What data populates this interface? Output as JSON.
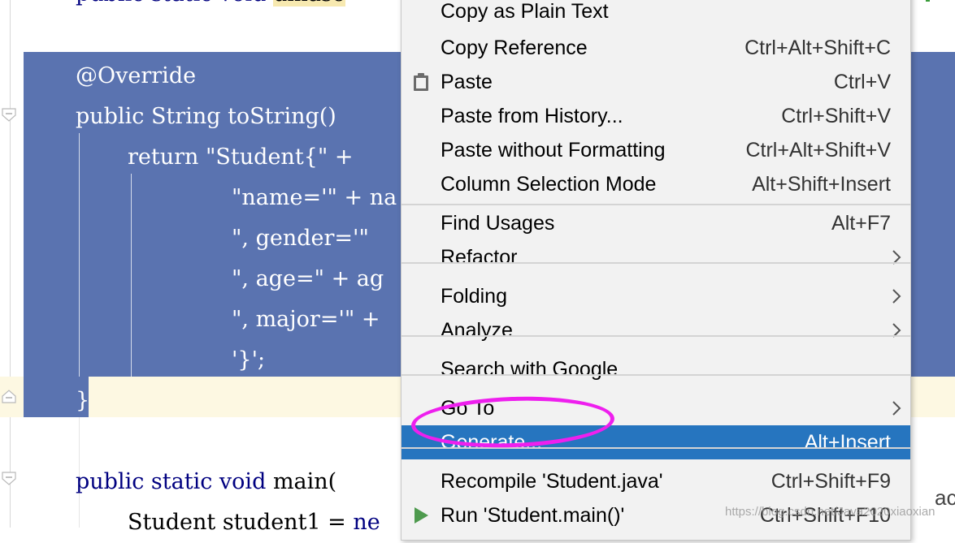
{
  "editor": {
    "line_top_prefix": "public static void ",
    "line_top_name": "dmaso",
    "line_override": "@Override",
    "line_tostring_kw": "public ",
    "line_tostring_rest": "String toString()",
    "line_return_kw": "return ",
    "line_return_rest": "\"Student{\" +",
    "line_name": "\"name='\" + na",
    "line_gender": "\", gender='\"",
    "line_age": "\", age=\" + ag",
    "line_major": "\", major='\" +",
    "line_close_str": "'}';",
    "line_brace": "}",
    "line_main_kw": "public static void ",
    "line_main_rest": "main(",
    "line_student_type": "Student student1 = ",
    "line_student_kw": "ne"
  },
  "context_menu": {
    "items": [
      {
        "label": "Copy as Plain Text",
        "shortcut": ""
      },
      {
        "label": "Copy Reference",
        "shortcut": "Ctrl+Alt+Shift+C"
      },
      {
        "label": "Paste",
        "shortcut": "Ctrl+V",
        "icon": "clipboard-icon"
      },
      {
        "label": "Paste from History...",
        "shortcut": "Ctrl+Shift+V"
      },
      {
        "label": "Paste without Formatting",
        "shortcut": "Ctrl+Alt+Shift+V"
      },
      {
        "label": "Column Selection Mode",
        "shortcut": "Alt+Shift+Insert"
      },
      {
        "label": "Find Usages",
        "shortcut": "Alt+F7"
      },
      {
        "label": "Refactor",
        "shortcut": "",
        "submenu": true
      },
      {
        "label": "Folding",
        "shortcut": "",
        "submenu": true
      },
      {
        "label": "Analyze",
        "shortcut": "",
        "submenu": true
      },
      {
        "label": "Search with Google",
        "shortcut": ""
      },
      {
        "label": "Go To",
        "shortcut": "",
        "submenu": true
      },
      {
        "label": "Generate...",
        "shortcut": "Alt+Insert",
        "active": true
      },
      {
        "label": "Recompile 'Student.java'",
        "shortcut": "Ctrl+Shift+F9"
      },
      {
        "label": "Run 'Student.main()'",
        "shortcut": "Ctrl+Shift+F10",
        "icon": "run-icon"
      }
    ]
  },
  "right_edge_label": "ac",
  "watermark": "https://blog.csdn.net/Java2020xiaoxian",
  "colors": {
    "selection": "#5a73b0",
    "menu_active": "#2675bf",
    "highlight_ellipse": "#ee1fee",
    "keyword": "#000080"
  }
}
